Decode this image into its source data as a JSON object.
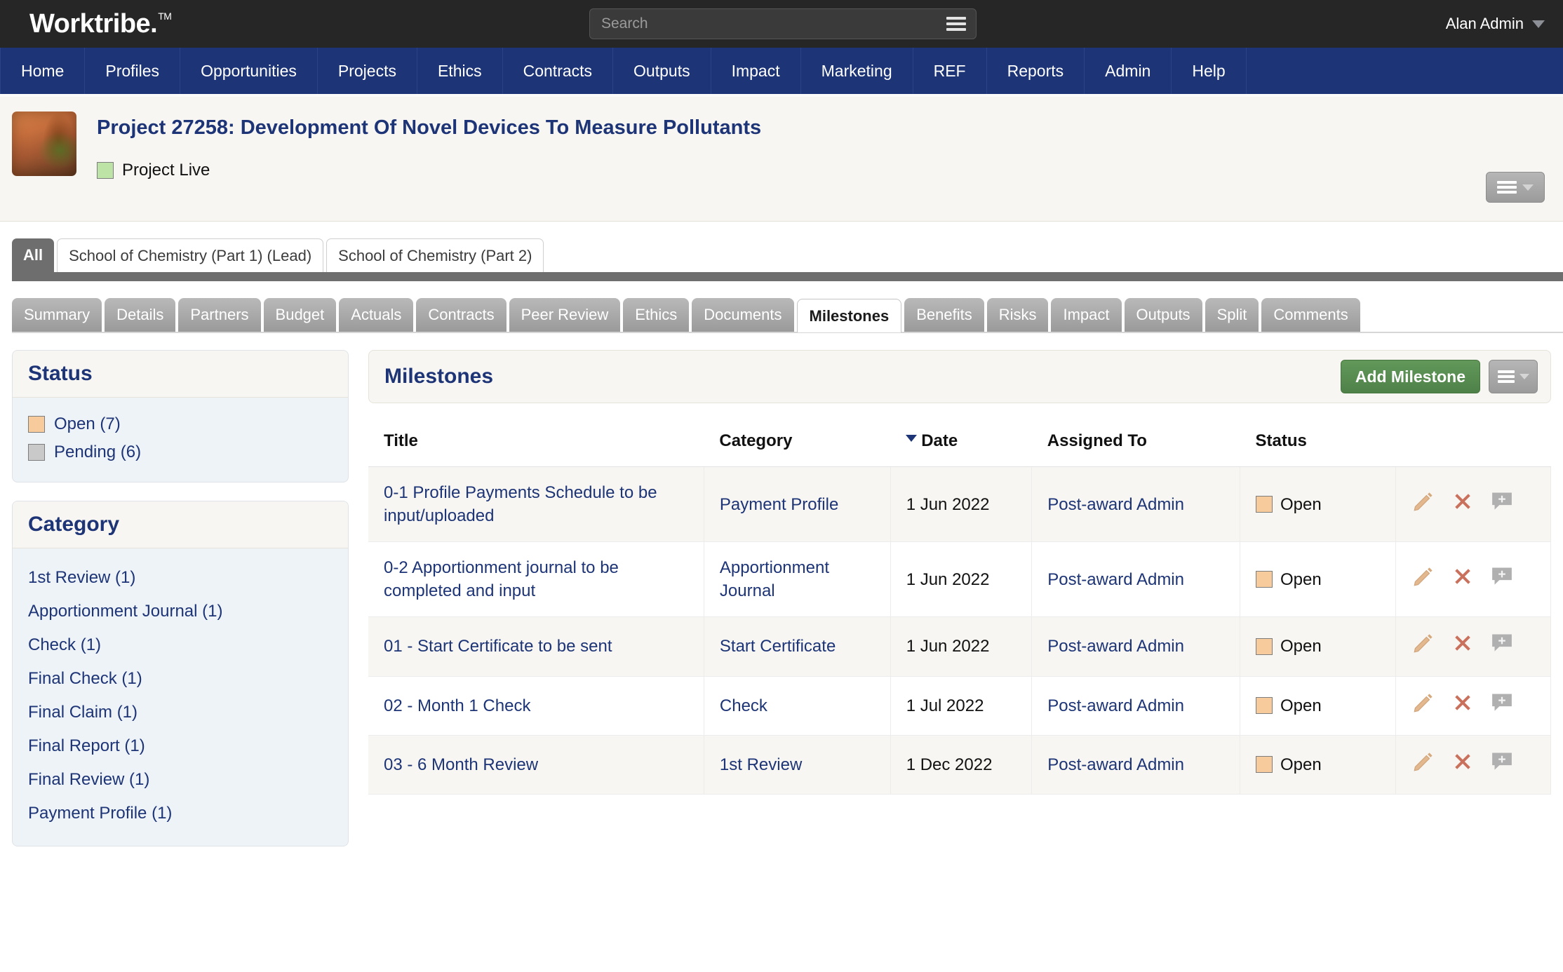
{
  "header": {
    "brand": "Worktribe.",
    "brand_tm": "TM",
    "search": {
      "value": "",
      "placeholder": "Search"
    },
    "user": "Alan Admin"
  },
  "main_nav": [
    {
      "label": "Home"
    },
    {
      "label": "Profiles"
    },
    {
      "label": "Opportunities"
    },
    {
      "label": "Projects"
    },
    {
      "label": "Ethics"
    },
    {
      "label": "Contracts"
    },
    {
      "label": "Outputs"
    },
    {
      "label": "Impact"
    },
    {
      "label": "Marketing"
    },
    {
      "label": "REF"
    },
    {
      "label": "Reports"
    },
    {
      "label": "Admin"
    },
    {
      "label": "Help"
    }
  ],
  "project": {
    "title": "Project 27258: Development Of Novel Devices To Measure Pollutants",
    "status_label": "Project Live",
    "status_color": "#bde3a6"
  },
  "part_tabs": [
    {
      "label": "All",
      "active": true
    },
    {
      "label": "School of Chemistry (Part 1) (Lead)",
      "active": false
    },
    {
      "label": "School of Chemistry (Part 2)",
      "active": false
    }
  ],
  "section_tabs": [
    {
      "label": "Summary",
      "active": false
    },
    {
      "label": "Details",
      "active": false
    },
    {
      "label": "Partners",
      "active": false
    },
    {
      "label": "Budget",
      "active": false
    },
    {
      "label": "Actuals",
      "active": false
    },
    {
      "label": "Contracts",
      "active": false
    },
    {
      "label": "Peer Review",
      "active": false
    },
    {
      "label": "Ethics",
      "active": false
    },
    {
      "label": "Documents",
      "active": false
    },
    {
      "label": "Milestones",
      "active": true
    },
    {
      "label": "Benefits",
      "active": false
    },
    {
      "label": "Risks",
      "active": false
    },
    {
      "label": "Impact",
      "active": false
    },
    {
      "label": "Outputs",
      "active": false
    },
    {
      "label": "Split",
      "active": false
    },
    {
      "label": "Comments",
      "active": false
    }
  ],
  "sidebar": {
    "status_panel": {
      "title": "Status",
      "items": [
        {
          "label": "Open (7)",
          "color": "#f7cb9c"
        },
        {
          "label": "Pending (6)",
          "color": "#c9c9c9"
        }
      ]
    },
    "category_panel": {
      "title": "Category",
      "items": [
        {
          "label": "1st Review (1)"
        },
        {
          "label": "Apportionment Journal (1)"
        },
        {
          "label": "Check (1)"
        },
        {
          "label": "Final Check (1)"
        },
        {
          "label": "Final Claim (1)"
        },
        {
          "label": "Final Report (1)"
        },
        {
          "label": "Final Review (1)"
        },
        {
          "label": "Payment Profile (1)"
        }
      ]
    }
  },
  "milestones": {
    "title": "Milestones",
    "add_button": "Add Milestone",
    "columns": {
      "title": "Title",
      "category": "Category",
      "date": "Date",
      "assigned_to": "Assigned To",
      "status": "Status"
    },
    "sort_column": "Date",
    "rows": [
      {
        "title": "0-1 Profile Payments Schedule to be input/uploaded",
        "category": "Payment Profile",
        "date": "1 Jun 2022",
        "assigned_to": "Post-award Admin",
        "status": "Open",
        "status_color": "#f7cb9c"
      },
      {
        "title": "0-2 Apportionment journal to be completed and input",
        "category": "Apportionment Journal",
        "date": "1 Jun 2022",
        "assigned_to": "Post-award Admin",
        "status": "Open",
        "status_color": "#f7cb9c"
      },
      {
        "title": "01 - Start Certificate to be sent",
        "category": "Start Certificate",
        "date": "1 Jun 2022",
        "assigned_to": "Post-award Admin",
        "status": "Open",
        "status_color": "#f7cb9c"
      },
      {
        "title": "02 - Month 1 Check",
        "category": "Check",
        "date": "1 Jul 2022",
        "assigned_to": "Post-award Admin",
        "status": "Open",
        "status_color": "#f7cb9c"
      },
      {
        "title": "03 - 6 Month Review",
        "category": "1st Review",
        "date": "1 Dec 2022",
        "assigned_to": "Post-award Admin",
        "status": "Open",
        "status_color": "#f7cb9c"
      }
    ],
    "row_actions": [
      {
        "name": "edit-icon",
        "title": "Edit"
      },
      {
        "name": "delete-icon",
        "title": "Delete"
      },
      {
        "name": "add-comment-icon",
        "title": "Add comment"
      }
    ]
  },
  "colors": {
    "nav_blue": "#1d3476",
    "topbar_dark": "#262626",
    "accent_green": "#4e8148",
    "link_blue": "#1d3476"
  }
}
